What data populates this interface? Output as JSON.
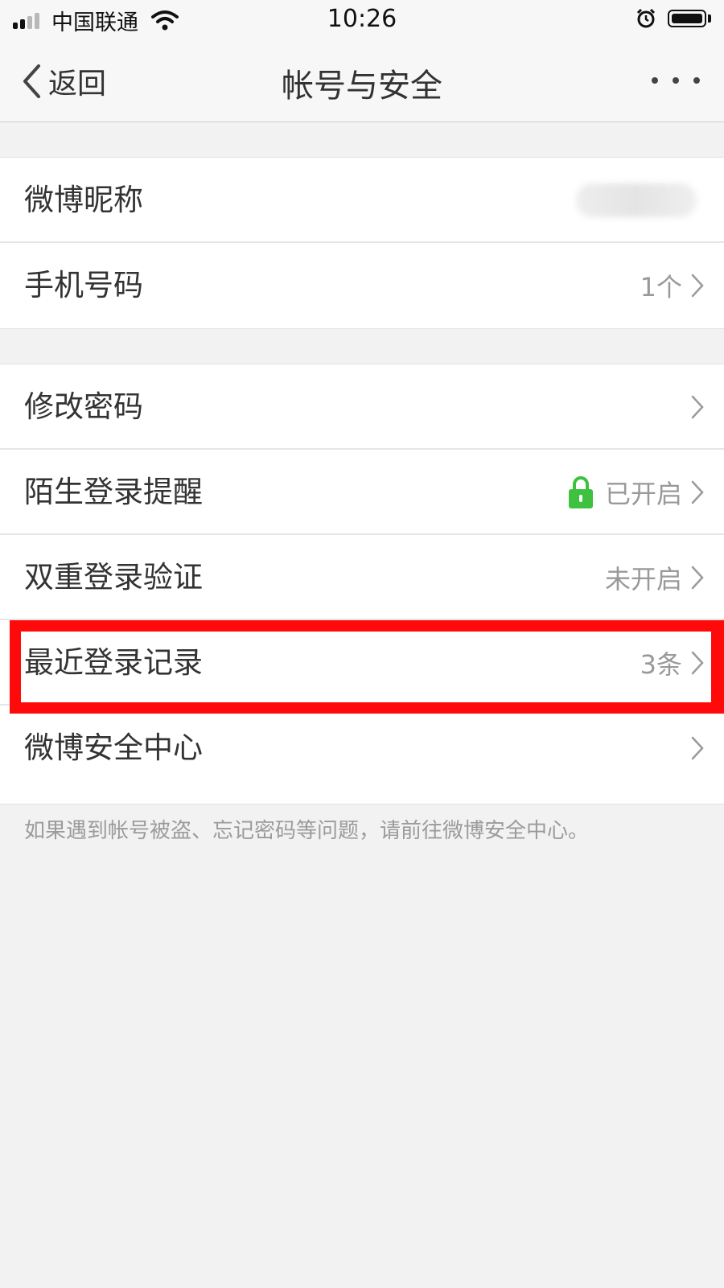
{
  "status_bar": {
    "carrier": "中国联通",
    "time": "10:26"
  },
  "nav": {
    "back_label": "返回",
    "title": "帐号与安全"
  },
  "groups": [
    {
      "items": [
        {
          "label": "微博昵称",
          "value": ""
        },
        {
          "label": "手机号码",
          "value": "1个"
        }
      ]
    },
    {
      "items": [
        {
          "label": "修改密码",
          "value": ""
        },
        {
          "label": "陌生登录提醒",
          "value": "已开启"
        },
        {
          "label": "双重登录验证",
          "value": "未开启"
        },
        {
          "label": "最近登录记录",
          "value": "3条"
        },
        {
          "label": "微博安全中心",
          "value": ""
        }
      ]
    }
  ],
  "footnote": "如果遇到帐号被盗、忘记密码等问题，请前往微博安全中心。",
  "colors": {
    "highlight": "#ff0a0a",
    "lock_green": "#3dc13f",
    "background": "#f2f2f2"
  }
}
